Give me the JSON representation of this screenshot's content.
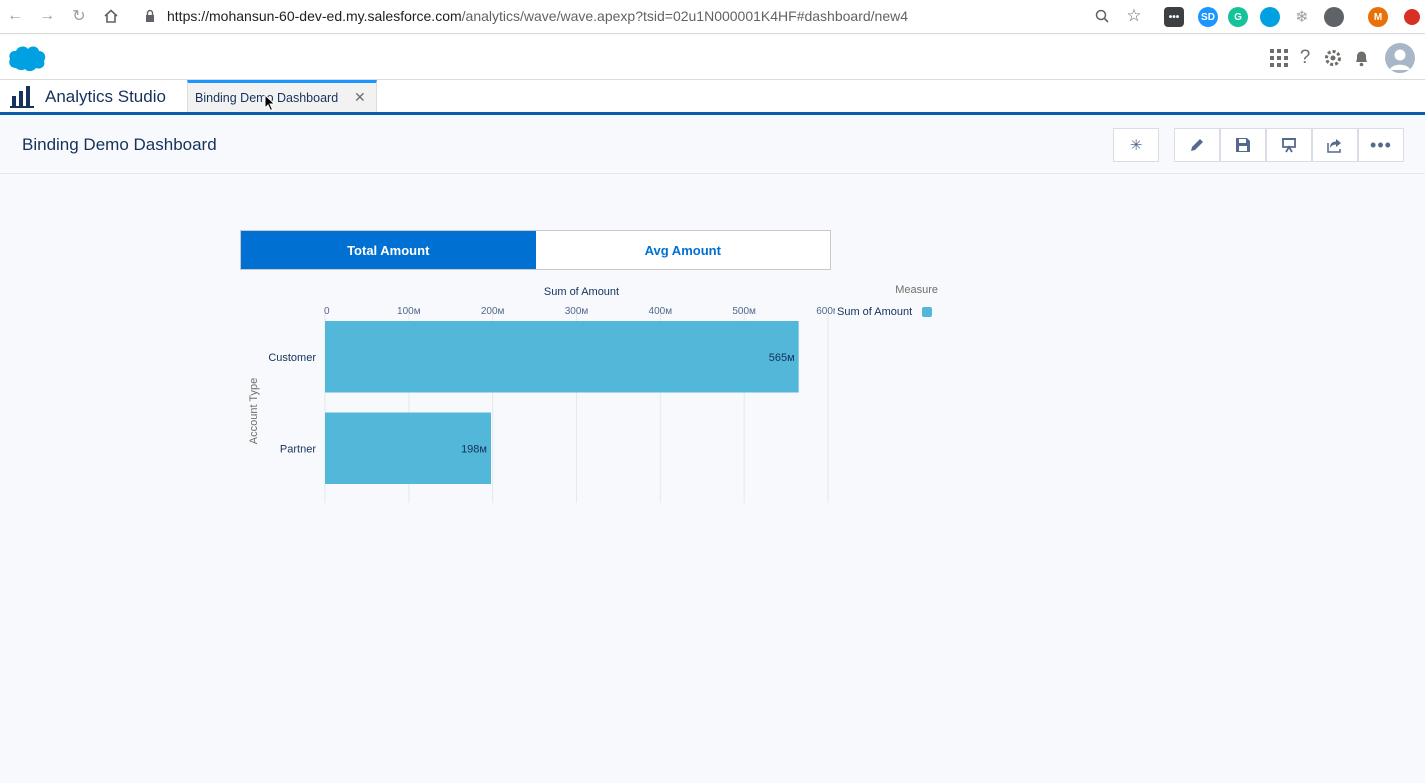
{
  "browser": {
    "url_host": "https://mohansun-60-dev-ed.my.salesforce.com",
    "url_path": "/analytics/wave/wave.apexp?tsid=02u1N000001K4HF#dashboard/new4",
    "profile_initial": "M"
  },
  "app": {
    "name": "Analytics Studio",
    "tab_label": "Binding Demo Dashboard"
  },
  "dashboard": {
    "title": "Binding Demo Dashboard",
    "toolbar": [
      "spark-icon",
      "pencil-icon",
      "save-icon",
      "present-icon",
      "share-icon",
      "more-icon"
    ]
  },
  "toggle": {
    "options": [
      "Total Amount",
      "Avg Amount"
    ],
    "selected": "Total Amount"
  },
  "legend": {
    "title": "Measure",
    "item": "Sum of Amount"
  },
  "colors": {
    "bar": "#52b7d8",
    "accent": "#0070d2"
  },
  "chart_data": {
    "type": "bar",
    "orientation": "horizontal",
    "title": "Sum of Amount",
    "xlabel": "Sum of Amount",
    "ylabel": "Account Type",
    "categories": [
      "Customer",
      "Partner"
    ],
    "values": [
      565,
      198
    ],
    "value_labels": [
      "565м",
      "198м"
    ],
    "xlim": [
      0,
      600
    ],
    "ticks": [
      0,
      100,
      200,
      300,
      400,
      500,
      600
    ],
    "tick_labels": [
      "0",
      "100м",
      "200м",
      "300м",
      "400м",
      "500м",
      "600м"
    ],
    "grid": true,
    "legend_position": "top-right"
  }
}
